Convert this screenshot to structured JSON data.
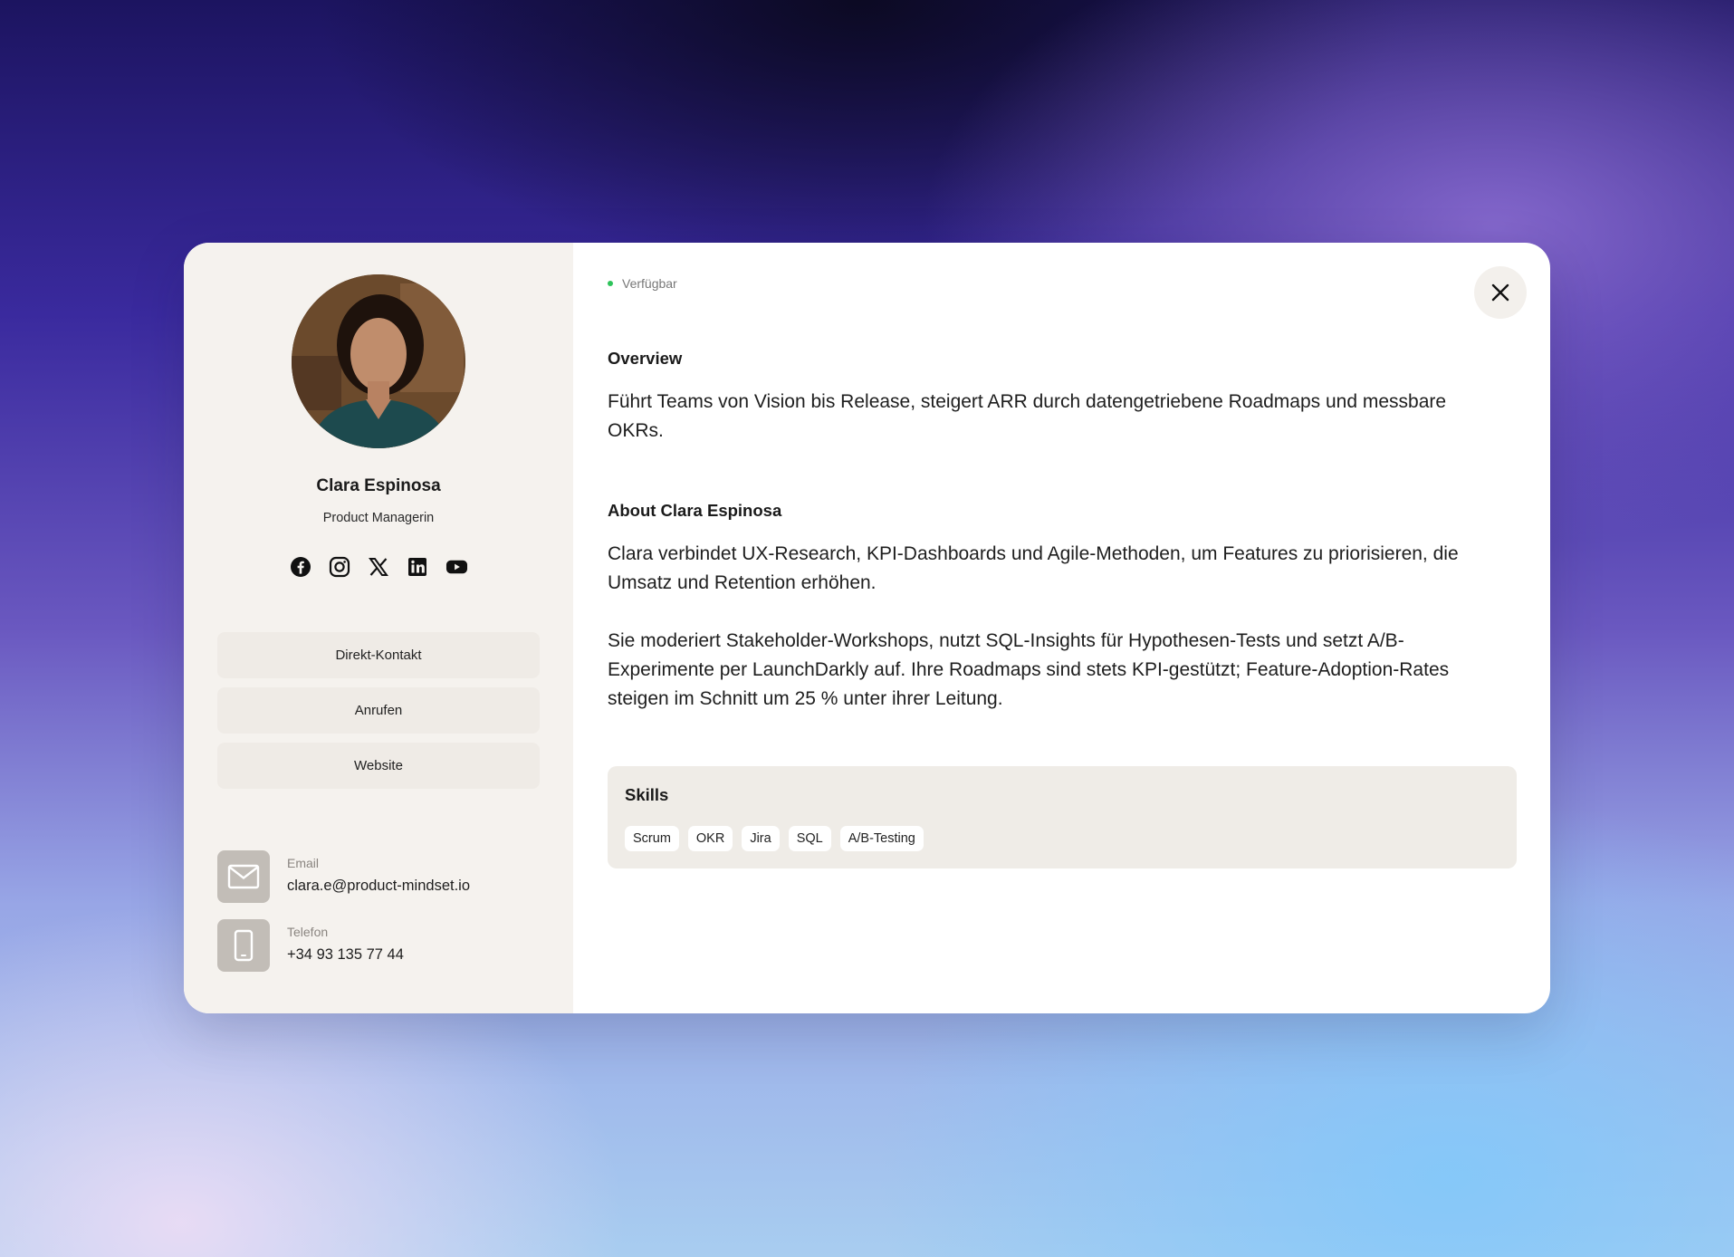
{
  "profile": {
    "name": "Clara Espinosa",
    "role": "Product Managerin",
    "status": "Verfügbar"
  },
  "socials": [
    {
      "icon": "facebook-icon"
    },
    {
      "icon": "instagram-icon"
    },
    {
      "icon": "x-icon"
    },
    {
      "icon": "linkedin-icon"
    },
    {
      "icon": "youtube-icon"
    }
  ],
  "actions": {
    "contact": "Direkt-Kontakt",
    "call": "Anrufen",
    "website": "Website"
  },
  "contact": {
    "email_label": "Email",
    "email_value": "clara.e@product-mindset.io",
    "phone_label": "Telefon",
    "phone_value": "+34 93 135 77 44"
  },
  "overview": {
    "title": "Overview",
    "text": "Führt Teams von Vision bis Release, steigert ARR durch datengetriebene Roadmaps und messbare OKRs."
  },
  "about": {
    "title": "About Clara Espinosa",
    "p1": "Clara verbindet UX-Research, KPI-Dashboards und Agile-Methoden, um Features zu priorisieren, die Umsatz und Retention erhöhen.",
    "p2": "Sie moderiert Stakeholder-Workshops, nutzt SQL-Insights für Hypothesen-Tests und setzt A/B-Experimente per LaunchDarkly auf. Ihre Roadmaps sind stets KPI-gestützt; Feature-Adoption-Rates steigen im Schnitt um 25 % unter ihrer Leitung."
  },
  "skills": {
    "title": "Skills",
    "tags": [
      "Scrum",
      "OKR",
      "Jira",
      "SQL",
      "A/B-Testing"
    ]
  },
  "colors": {
    "status_dot": "#2ec35a",
    "left_panel": "#f5f2ee",
    "button_bg": "#efebe6"
  }
}
